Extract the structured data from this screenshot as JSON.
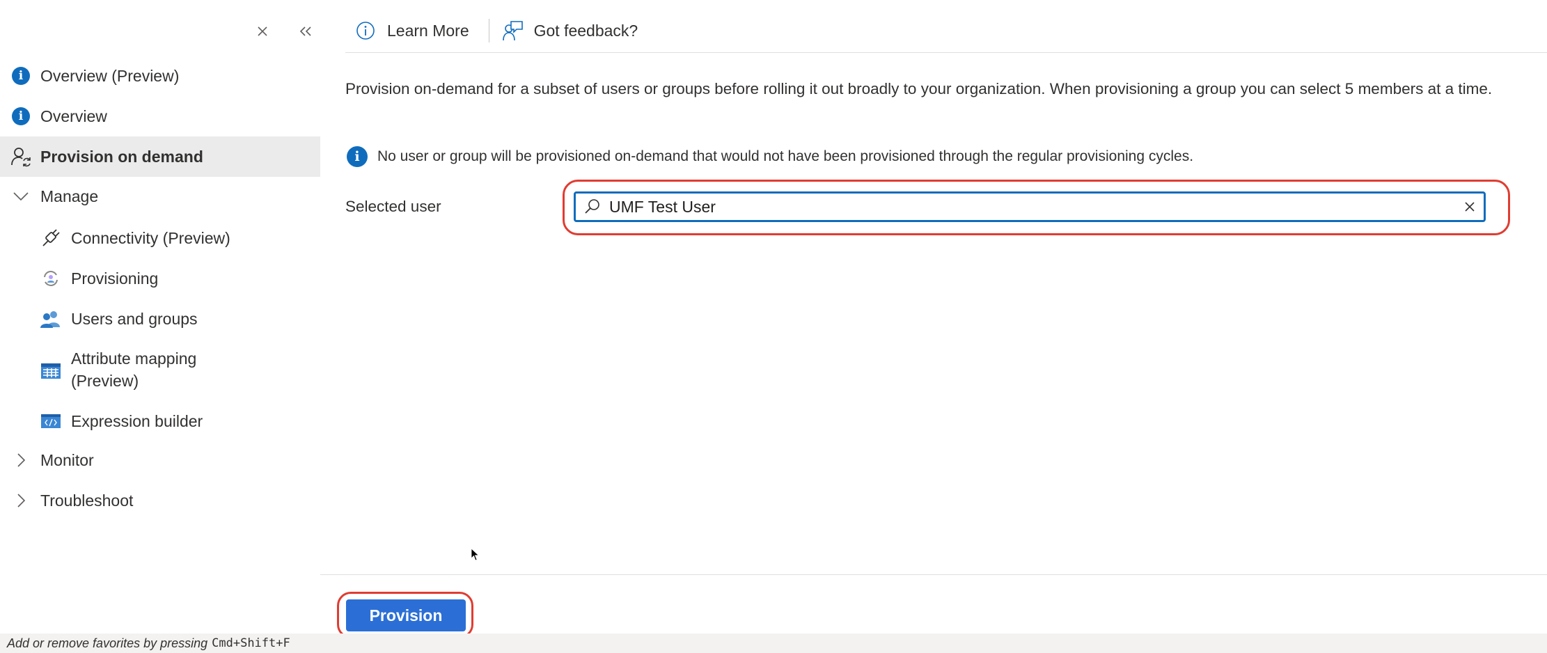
{
  "sidebar": {
    "items": [
      {
        "label": "Overview (Preview)",
        "icon": "info-icon"
      },
      {
        "label": "Overview",
        "icon": "info-icon"
      },
      {
        "label": "Provision on demand",
        "icon": "user-sync-icon",
        "selected": true
      },
      {
        "label": "Manage",
        "icon": "chevron-down-icon"
      },
      {
        "label": "Connectivity (Preview)",
        "icon": "plug-icon"
      },
      {
        "label": "Provisioning",
        "icon": "provisioning-icon"
      },
      {
        "label": "Users and groups",
        "icon": "users-icon"
      },
      {
        "label": "Attribute mapping",
        "label2": "(Preview)",
        "icon": "table-icon"
      },
      {
        "label": "Expression builder",
        "icon": "code-icon"
      },
      {
        "label": "Monitor",
        "icon": "chevron-right-icon"
      },
      {
        "label": "Troubleshoot",
        "icon": "chevron-right-icon"
      }
    ]
  },
  "toolbar": {
    "learn_more": "Learn More",
    "feedback": "Got feedback?"
  },
  "content": {
    "description": "Provision on-demand for a subset of users or groups before rolling it out broadly to your organization. When provisioning a group you can select 5 members at a time.",
    "note": "No user or group will be provisioned on-demand that would not have been provisioned through the regular provisioning cycles.",
    "selected_user_label": "Selected user",
    "selected_user_value": "UMF Test User"
  },
  "footer": {
    "provision_label": "Provision"
  },
  "status": {
    "hint": "Add or remove favorites by pressing",
    "shortcut": "Cmd+Shift+F"
  },
  "colors": {
    "accent": "#0f6cbd",
    "button": "#2b6fd6",
    "highlight": "#e03c31",
    "selected_bg": "#ebebeb"
  }
}
